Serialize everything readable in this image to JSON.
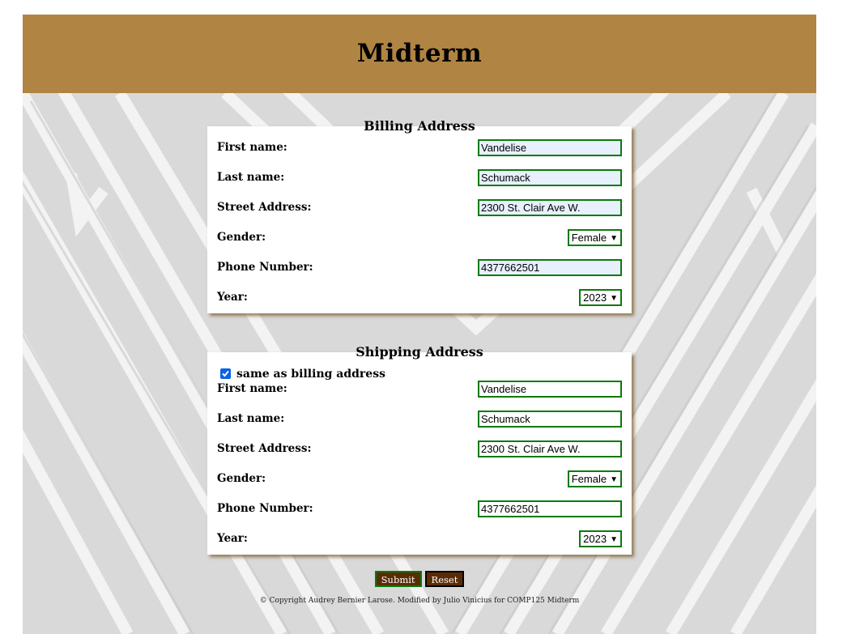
{
  "header": {
    "title": "Midterm"
  },
  "billing": {
    "legend": "Billing Address",
    "first_name_label": "First name:",
    "first_name_value": "Vandelise",
    "last_name_label": "Last name:",
    "last_name_value": "Schumack",
    "street_label": "Street Address:",
    "street_value": "2300 St. Clair Ave W.",
    "gender_label": "Gender:",
    "gender_value": "Female",
    "phone_label": "Phone Number:",
    "phone_value": "4377662501",
    "year_label": "Year:",
    "year_value": "2023"
  },
  "shipping": {
    "legend": "Shipping Address",
    "same_as_label": "same as billing address",
    "same_as_checked": true,
    "first_name_label": "First name:",
    "first_name_value": "Vandelise",
    "last_name_label": "Last name:",
    "last_name_value": "Schumack",
    "street_label": "Street Address:",
    "street_value": "2300 St. Clair Ave W.",
    "gender_label": "Gender:",
    "gender_value": "Female",
    "phone_label": "Phone Number:",
    "phone_value": "4377662501",
    "year_label": "Year:",
    "year_value": "2023"
  },
  "buttons": {
    "submit_label": "Submit",
    "reset_label": "Reset"
  },
  "footer": {
    "text": "© Copyright Audrey Bernier Larose. Modified by Julio Vinicius for COMP125 Midterm"
  },
  "colors": {
    "header_bg": "#b08442",
    "field_border": "#0a7a0a",
    "autofill_bg": "#e8f0fe",
    "button_bg": "#5a2c06",
    "checkbox": "#0b63e6"
  }
}
